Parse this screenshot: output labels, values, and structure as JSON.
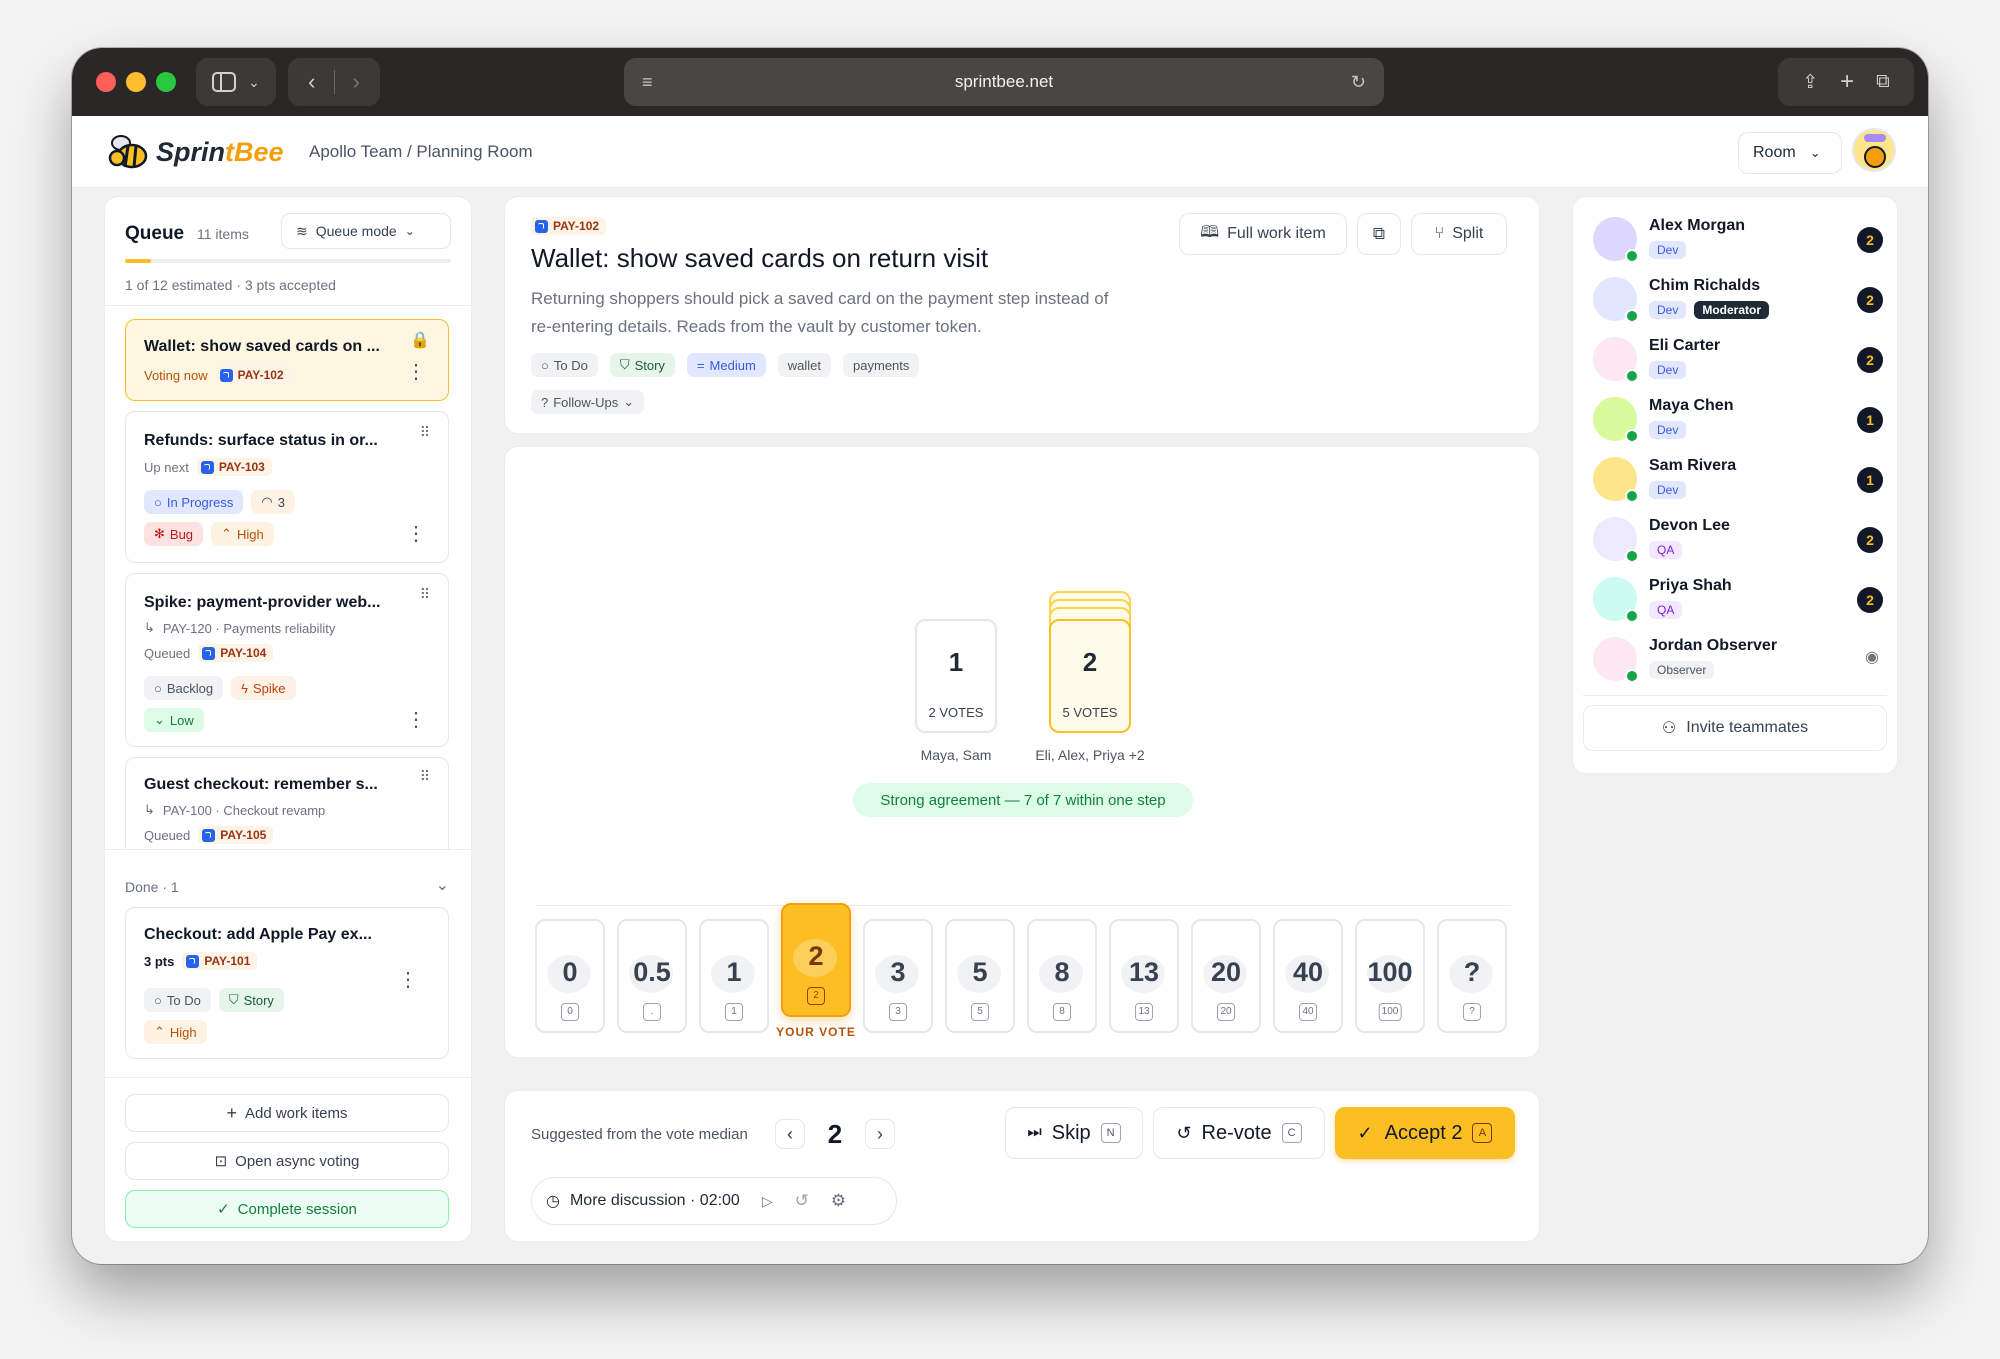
{
  "browser": {
    "url": "sprintbee.net"
  },
  "app": {
    "logo": "SprintBee",
    "breadcrumb": "Apollo Team / Planning Room",
    "room_label": "Room"
  },
  "queue": {
    "title": "Queue",
    "count": "11 items",
    "mode_label": "Queue mode",
    "progress_text": "1 of 12 estimated · 3 pts accepted",
    "progress_fraction": 0.08,
    "items": [
      {
        "title": "Wallet: show saved cards on ...",
        "status": "Voting now",
        "id": "PAY-102"
      },
      {
        "title": "Refunds: surface status in or...",
        "status": "Up next",
        "id": "PAY-103",
        "pills": [
          "In Progress",
          "3",
          "Bug",
          "High"
        ]
      },
      {
        "title": "Spike: payment-provider web...",
        "parent": "PAY-120 · Payments reliability",
        "status": "Queued",
        "id": "PAY-104",
        "pills": [
          "Backlog",
          "Spike",
          "Low"
        ]
      },
      {
        "title": "Guest checkout: remember s...",
        "parent": "PAY-100 · Checkout revamp",
        "status": "Queued",
        "id": "PAY-105"
      }
    ],
    "done_label": "Done · 1",
    "done_items": [
      {
        "title": "Checkout: add Apple Pay ex...",
        "points": "3 pts",
        "id": "PAY-101",
        "pills": [
          "To Do",
          "Story",
          "High"
        ]
      }
    ],
    "actions": {
      "add": "Add work items",
      "async": "Open async voting",
      "complete": "Complete session"
    }
  },
  "item": {
    "id": "PAY-102",
    "title": "Wallet: show saved cards on return visit",
    "description_1": "Returning shoppers should pick a saved card on the payment step instead of",
    "description_2": "re-entering details. Reads from the vault by customer token.",
    "tags": [
      "To Do",
      "Story",
      "Medium",
      "wallet",
      "payments"
    ],
    "followups": "Follow-Ups",
    "buttons": {
      "full": "Full work item",
      "split": "Split"
    }
  },
  "results": {
    "cards": [
      {
        "value": "1",
        "votes": "2 VOTES",
        "voters": "Maya, Sam"
      },
      {
        "value": "2",
        "votes": "5 VOTES",
        "voters": "Eli, Alex, Priya +2"
      }
    ],
    "agreement": "Strong agreement — 7 of 7 within one step"
  },
  "deck": {
    "cards": [
      "0",
      "0.5",
      "1",
      "2",
      "3",
      "5",
      "8",
      "13",
      "20",
      "40",
      "100",
      "?"
    ],
    "keys": [
      "0",
      ".",
      "1",
      "2",
      "3",
      "5",
      "8",
      "13",
      "20",
      "40",
      "100",
      "?"
    ],
    "selected": "2",
    "your_vote_label": "YOUR VOTE"
  },
  "footer": {
    "suggest_label": "Suggested from the vote median",
    "suggested": "2",
    "skip": "Skip",
    "skip_key": "N",
    "revote": "Re-vote",
    "revote_key": "C",
    "accept": "Accept 2",
    "accept_key": "A",
    "timer": "More discussion · 02:00"
  },
  "participants": [
    {
      "name": "Alex Morgan",
      "role": "Dev",
      "vote": "2"
    },
    {
      "name": "Chim Richalds",
      "role": "Dev",
      "badge": "Moderator",
      "vote": "2"
    },
    {
      "name": "Eli Carter",
      "role": "Dev",
      "vote": "2"
    },
    {
      "name": "Maya Chen",
      "role": "Dev",
      "vote": "1"
    },
    {
      "name": "Sam Rivera",
      "role": "Dev",
      "vote": "1"
    },
    {
      "name": "Devon Lee",
      "role": "QA",
      "vote": "2"
    },
    {
      "name": "Priya Shah",
      "role": "QA",
      "vote": "2"
    },
    {
      "name": "Jordan Observer",
      "role": "Observer"
    }
  ],
  "invite": "Invite teammates",
  "colors": {
    "accent": "#fbbf24",
    "accent_light": "#fef6e0",
    "success": "#16a34a",
    "dark": "#111827"
  }
}
